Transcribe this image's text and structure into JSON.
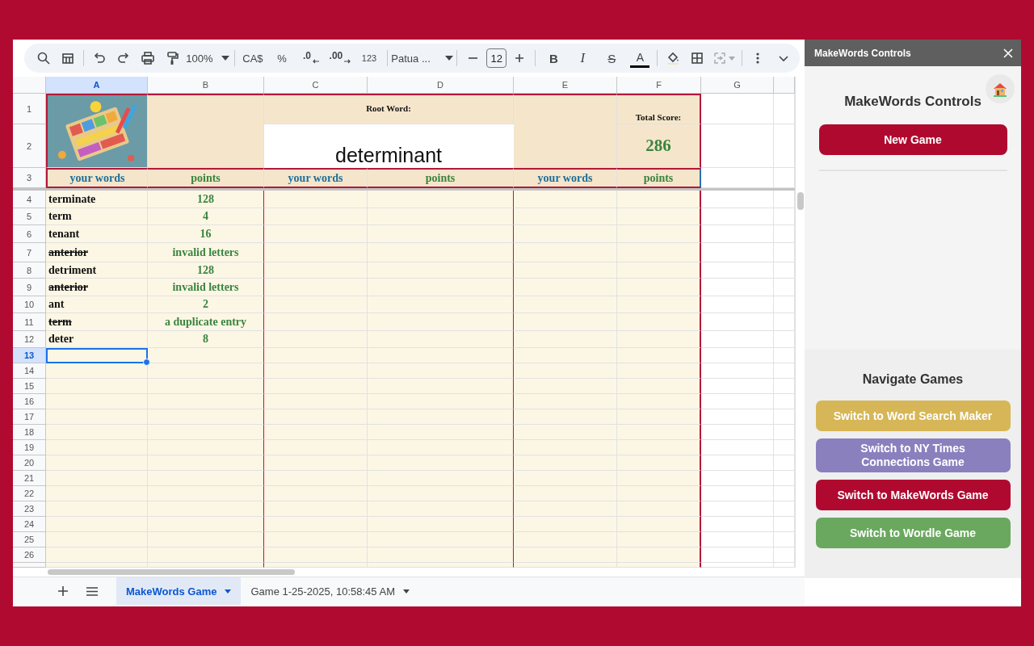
{
  "toolbar": {
    "zoom": "100%",
    "currency": "CA$",
    "percent": "%",
    "decrease_decimals": ".0",
    "increase_decimals": ".00",
    "number_format": "123",
    "font": "Patua ...",
    "font_size": "12",
    "bold": "B",
    "italic": "I",
    "strikethrough": "S",
    "text_color": "A"
  },
  "columns": [
    {
      "label": "A",
      "selected": true
    },
    {
      "label": "B",
      "selected": false
    },
    {
      "label": "C",
      "selected": false
    },
    {
      "label": "D",
      "selected": false
    },
    {
      "label": "E",
      "selected": false
    },
    {
      "label": "F",
      "selected": false
    },
    {
      "label": "G",
      "selected": false
    }
  ],
  "header": {
    "row_numbers": [
      "1",
      "2",
      "3"
    ],
    "logo": {
      "kind": "picture"
    },
    "root_word_label": "Root Word:",
    "root_word": "determinant",
    "total_score_label": "Total Score:",
    "total_score": "286",
    "column_labels": [
      {
        "label": "your words",
        "kind": "words"
      },
      {
        "label": "points",
        "kind": "points"
      },
      {
        "label": "your words",
        "kind": "words"
      },
      {
        "label": "points",
        "kind": "points"
      },
      {
        "label": "your words",
        "kind": "words"
      },
      {
        "label": "points",
        "kind": "points"
      }
    ]
  },
  "rows": [
    {
      "number": "4",
      "word": "terminate",
      "points": "128",
      "struck": false,
      "selected": false
    },
    {
      "number": "5",
      "word": "term",
      "points": "4",
      "struck": false,
      "selected": false
    },
    {
      "number": "6",
      "word": "tenant",
      "points": "16",
      "struck": false,
      "selected": false
    },
    {
      "number": "7",
      "word": "anterior",
      "points": "invalid letters",
      "struck": true,
      "selected": false
    },
    {
      "number": "8",
      "word": "detriment",
      "points": "128",
      "struck": false,
      "selected": false
    },
    {
      "number": "9",
      "word": "anterior",
      "points": "invalid letters",
      "struck": true,
      "selected": false
    },
    {
      "number": "10",
      "word": "ant",
      "points": "2",
      "struck": false,
      "selected": false
    },
    {
      "number": "11",
      "word": "term",
      "points": "a duplicate entry",
      "struck": true,
      "selected": false
    },
    {
      "number": "12",
      "word": "deter",
      "points": "8",
      "struck": false,
      "selected": false
    },
    {
      "number": "13",
      "selected": true
    },
    {
      "number": "14",
      "selected": false
    },
    {
      "number": "15",
      "selected": false
    },
    {
      "number": "16",
      "selected": false
    },
    {
      "number": "17",
      "selected": false
    },
    {
      "number": "18",
      "selected": false
    },
    {
      "number": "19",
      "selected": false
    },
    {
      "number": "20",
      "selected": false
    },
    {
      "number": "21",
      "selected": false
    },
    {
      "number": "22",
      "selected": false
    },
    {
      "number": "23",
      "selected": false
    },
    {
      "number": "24",
      "selected": false
    },
    {
      "number": "25",
      "selected": false
    },
    {
      "number": "26",
      "selected": false
    }
  ],
  "sheet_tabs": [
    {
      "label": "MakeWords Game",
      "selected": true
    },
    {
      "label": "Game 1-25-2025, 10:58:45 AM",
      "selected": false
    }
  ],
  "sidebar": {
    "title": "MakeWords Controls",
    "heading": "MakeWords Controls",
    "new_game": "New Game",
    "navigate_heading": "Navigate Games",
    "nav_buttons": [
      {
        "label": "Switch to Word Search Maker",
        "color": "#d6b656"
      },
      {
        "label": "Switch to NY Times Connections Game",
        "color": "#8a80be"
      },
      {
        "label": "Switch to MakeWords Game",
        "color": "#b0092f"
      },
      {
        "label": "Switch to Wordle Game",
        "color": "#6aa85f"
      }
    ]
  }
}
